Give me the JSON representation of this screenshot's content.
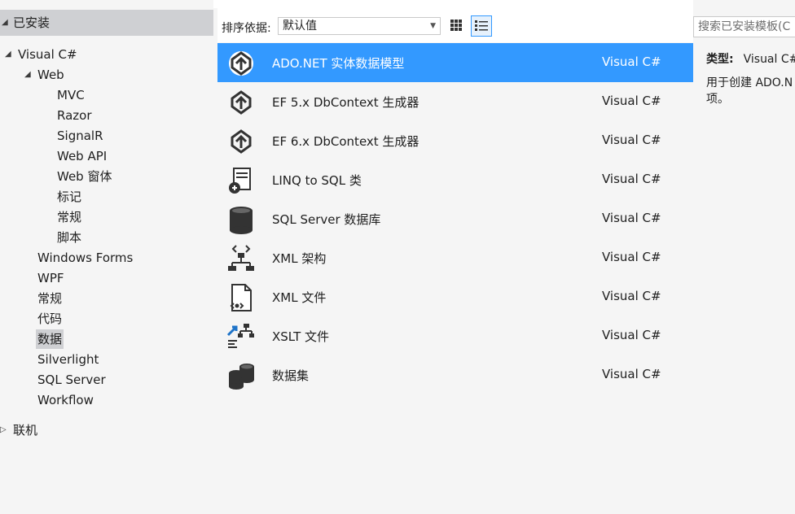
{
  "tree": {
    "installed": "已安装",
    "visual_csharp": "Visual C#",
    "web": "Web",
    "web_children": [
      "MVC",
      "Razor",
      "SignalR",
      "Web API",
      "Web 窗体",
      "标记",
      "常规",
      "脚本"
    ],
    "csharp_children": [
      "Windows Forms",
      "WPF",
      "常规",
      "代码",
      "数据",
      "Silverlight",
      "SQL Server",
      "Workflow"
    ],
    "selected": "数据",
    "online": "联机"
  },
  "toolbar": {
    "sort_label": "排序依据:",
    "sort_value": "默认值"
  },
  "templates": [
    {
      "name": "ADO.NET 实体数据模型",
      "lang": "Visual C#",
      "icon": "entity-model-icon",
      "selected": true
    },
    {
      "name": "EF 5.x DbContext 生成器",
      "lang": "Visual C#",
      "icon": "entity-model-icon"
    },
    {
      "name": "EF 6.x DbContext 生成器",
      "lang": "Visual C#",
      "icon": "entity-model-icon"
    },
    {
      "name": "LINQ to SQL 类",
      "lang": "Visual C#",
      "icon": "linq-to-sql-icon"
    },
    {
      "name": "SQL Server 数据库",
      "lang": "Visual C#",
      "icon": "database-icon"
    },
    {
      "name": "XML 架构",
      "lang": "Visual C#",
      "icon": "xml-schema-icon"
    },
    {
      "name": "XML 文件",
      "lang": "Visual C#",
      "icon": "xml-file-icon"
    },
    {
      "name": "XSLT 文件",
      "lang": "Visual C#",
      "icon": "xslt-file-icon"
    },
    {
      "name": "数据集",
      "lang": "Visual C#",
      "icon": "dataset-icon"
    }
  ],
  "details": {
    "search_placeholder": "搜索已安装模板(C",
    "type_label": "类型:",
    "type_value": "Visual C#",
    "description": "用于创建 ADO.N\n项。"
  },
  "colors": {
    "selection": "#3399ff",
    "header_bg": "#cfd0d3",
    "panel_bg": "#f5f5f5"
  }
}
